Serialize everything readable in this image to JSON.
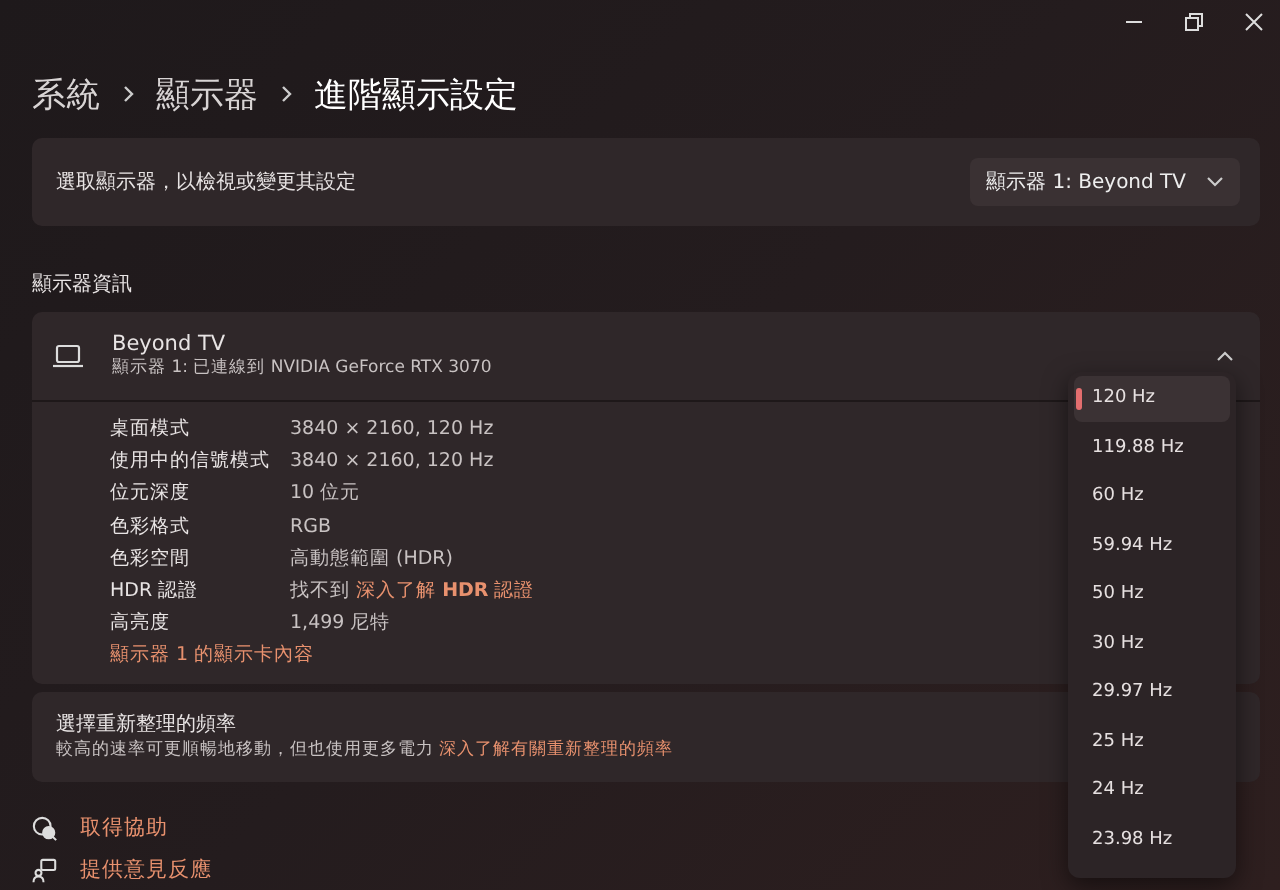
{
  "breadcrumb": [
    "系統",
    "顯示器",
    "進階顯示設定"
  ],
  "display_select": {
    "label": "選取顯示器，以檢視或變更其設定",
    "value": "顯示器 1: Beyond TV"
  },
  "section_title": "顯示器資訊",
  "display_card": {
    "name": "Beyond TV",
    "subtitle": "顯示器 1: 已連線到 NVIDIA GeForce RTX 3070",
    "expanded": true,
    "details": [
      {
        "label": "桌面模式",
        "value": "3840 × 2160, 120 Hz"
      },
      {
        "label": "使用中的信號模式",
        "value": "3840 × 2160, 120 Hz"
      },
      {
        "label": "位元深度",
        "value": "10 位元"
      },
      {
        "label": "色彩格式",
        "value": "RGB"
      },
      {
        "label": "色彩空間",
        "value": "高動態範圍 (HDR)"
      },
      {
        "label": "HDR 認證",
        "value": "找不到",
        "link": "深入了解 **HDR** 認證"
      },
      {
        "label": "高亮度",
        "value": "1,499 尼特"
      }
    ],
    "adapter_link": "顯示器 1 的顯示卡內容"
  },
  "refresh_card": {
    "title": "選擇重新整理的頻率",
    "description": "較高的速率可更順暢地移動，但也使用更多電力",
    "link": "深入了解有關重新整理的頻率"
  },
  "refresh_menu": [
    {
      "label": "120 Hz",
      "selected": true
    },
    {
      "label": "119.88 Hz",
      "selected": false
    },
    {
      "label": "60 Hz",
      "selected": false
    },
    {
      "label": "59.94 Hz",
      "selected": false
    },
    {
      "label": "50 Hz",
      "selected": false
    },
    {
      "label": "30 Hz",
      "selected": false
    },
    {
      "label": "29.97 Hz",
      "selected": false
    },
    {
      "label": "25 Hz",
      "selected": false
    },
    {
      "label": "24 Hz",
      "selected": false
    },
    {
      "label": "23.98 Hz",
      "selected": false
    }
  ],
  "footer_links": [
    {
      "kind": "help",
      "label": "取得協助"
    },
    {
      "kind": "feedback",
      "label": "提供意見反應"
    }
  ]
}
